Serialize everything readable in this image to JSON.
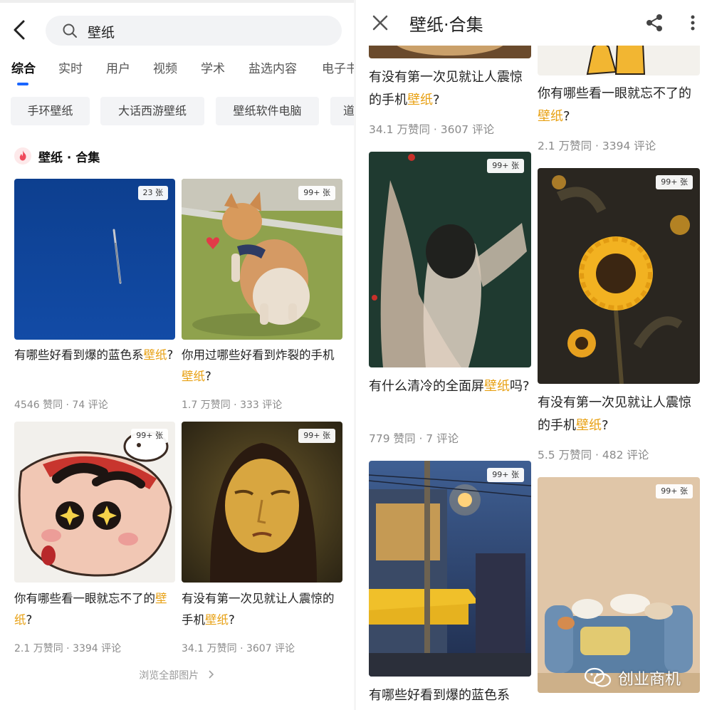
{
  "left": {
    "search": {
      "query": "壁纸"
    },
    "tabs": [
      "综合",
      "实时",
      "用户",
      "视频",
      "学术",
      "盐选内容",
      "电子书"
    ],
    "chips": [
      "手环壁纸",
      "大话西游壁纸",
      "壁纸软件电脑",
      "道"
    ],
    "section": {
      "title": "壁纸 · 合集"
    },
    "cards": [
      {
        "badge": "23 张",
        "title_pre": "有哪些好看到爆的蓝色系",
        "title_hl": "壁纸",
        "title_post": "?",
        "meta": "4546 赞同 · 74 评论"
      },
      {
        "badge": "99+ 张",
        "title_pre": "你用过哪些好看到炸裂的手机",
        "title_hl": "壁纸",
        "title_post": "?",
        "meta": "1.7 万赞同 · 333 评论"
      },
      {
        "badge": "99+ 张",
        "title_pre": "你有哪些看一眼就忘不了的",
        "title_hl": "壁纸",
        "title_post": "?",
        "meta": "2.1 万赞同 · 3394 评论"
      },
      {
        "badge": "99+ 张",
        "title_pre": "有没有第一次见就让人震惊的手机",
        "title_hl": "壁纸",
        "title_post": "?",
        "meta": "34.1 万赞同 · 3607 评论"
      }
    ],
    "browse_all": "浏览全部图片"
  },
  "right": {
    "header": {
      "title": "壁纸·合集"
    },
    "col1": [
      {
        "title_pre": "有没有第一次见就让人震惊的手机",
        "title_hl": "壁纸",
        "title_post": "?",
        "meta": "34.1 万赞同 · 3607 评论"
      },
      {
        "badge": "99+ 张",
        "title_pre": "有什么清冷的全面屏",
        "title_hl": "壁纸",
        "title_post": "吗?",
        "meta": "779 赞同 · 7 评论"
      },
      {
        "badge": "99+ 张",
        "title_pre": "有哪些好看到爆的蓝色系",
        "title_hl": "",
        "title_post": "",
        "meta": ""
      }
    ],
    "col2": [
      {
        "title_pre": "你有哪些看一眼就忘不了的",
        "title_hl": "壁纸",
        "title_post": "?",
        "meta": "2.1 万赞同 · 3394 评论"
      },
      {
        "badge": "99+ 张",
        "title_pre": "有没有第一次见就让人震惊的手机",
        "title_hl": "壁纸",
        "title_post": "?",
        "meta": "5.5 万赞同 · 482 评论"
      },
      {
        "badge": "99+ 张"
      }
    ],
    "watermark": "创业商机"
  },
  "colors": {
    "accent": "#1a66ff",
    "highlight": "#e8a114",
    "meta": "#8a8a8a"
  },
  "icons": [
    "back-arrow-icon",
    "search-icon",
    "fire-icon",
    "chevron-right-icon",
    "close-icon",
    "share-icon",
    "more-vert-icon",
    "wechat-icon"
  ]
}
